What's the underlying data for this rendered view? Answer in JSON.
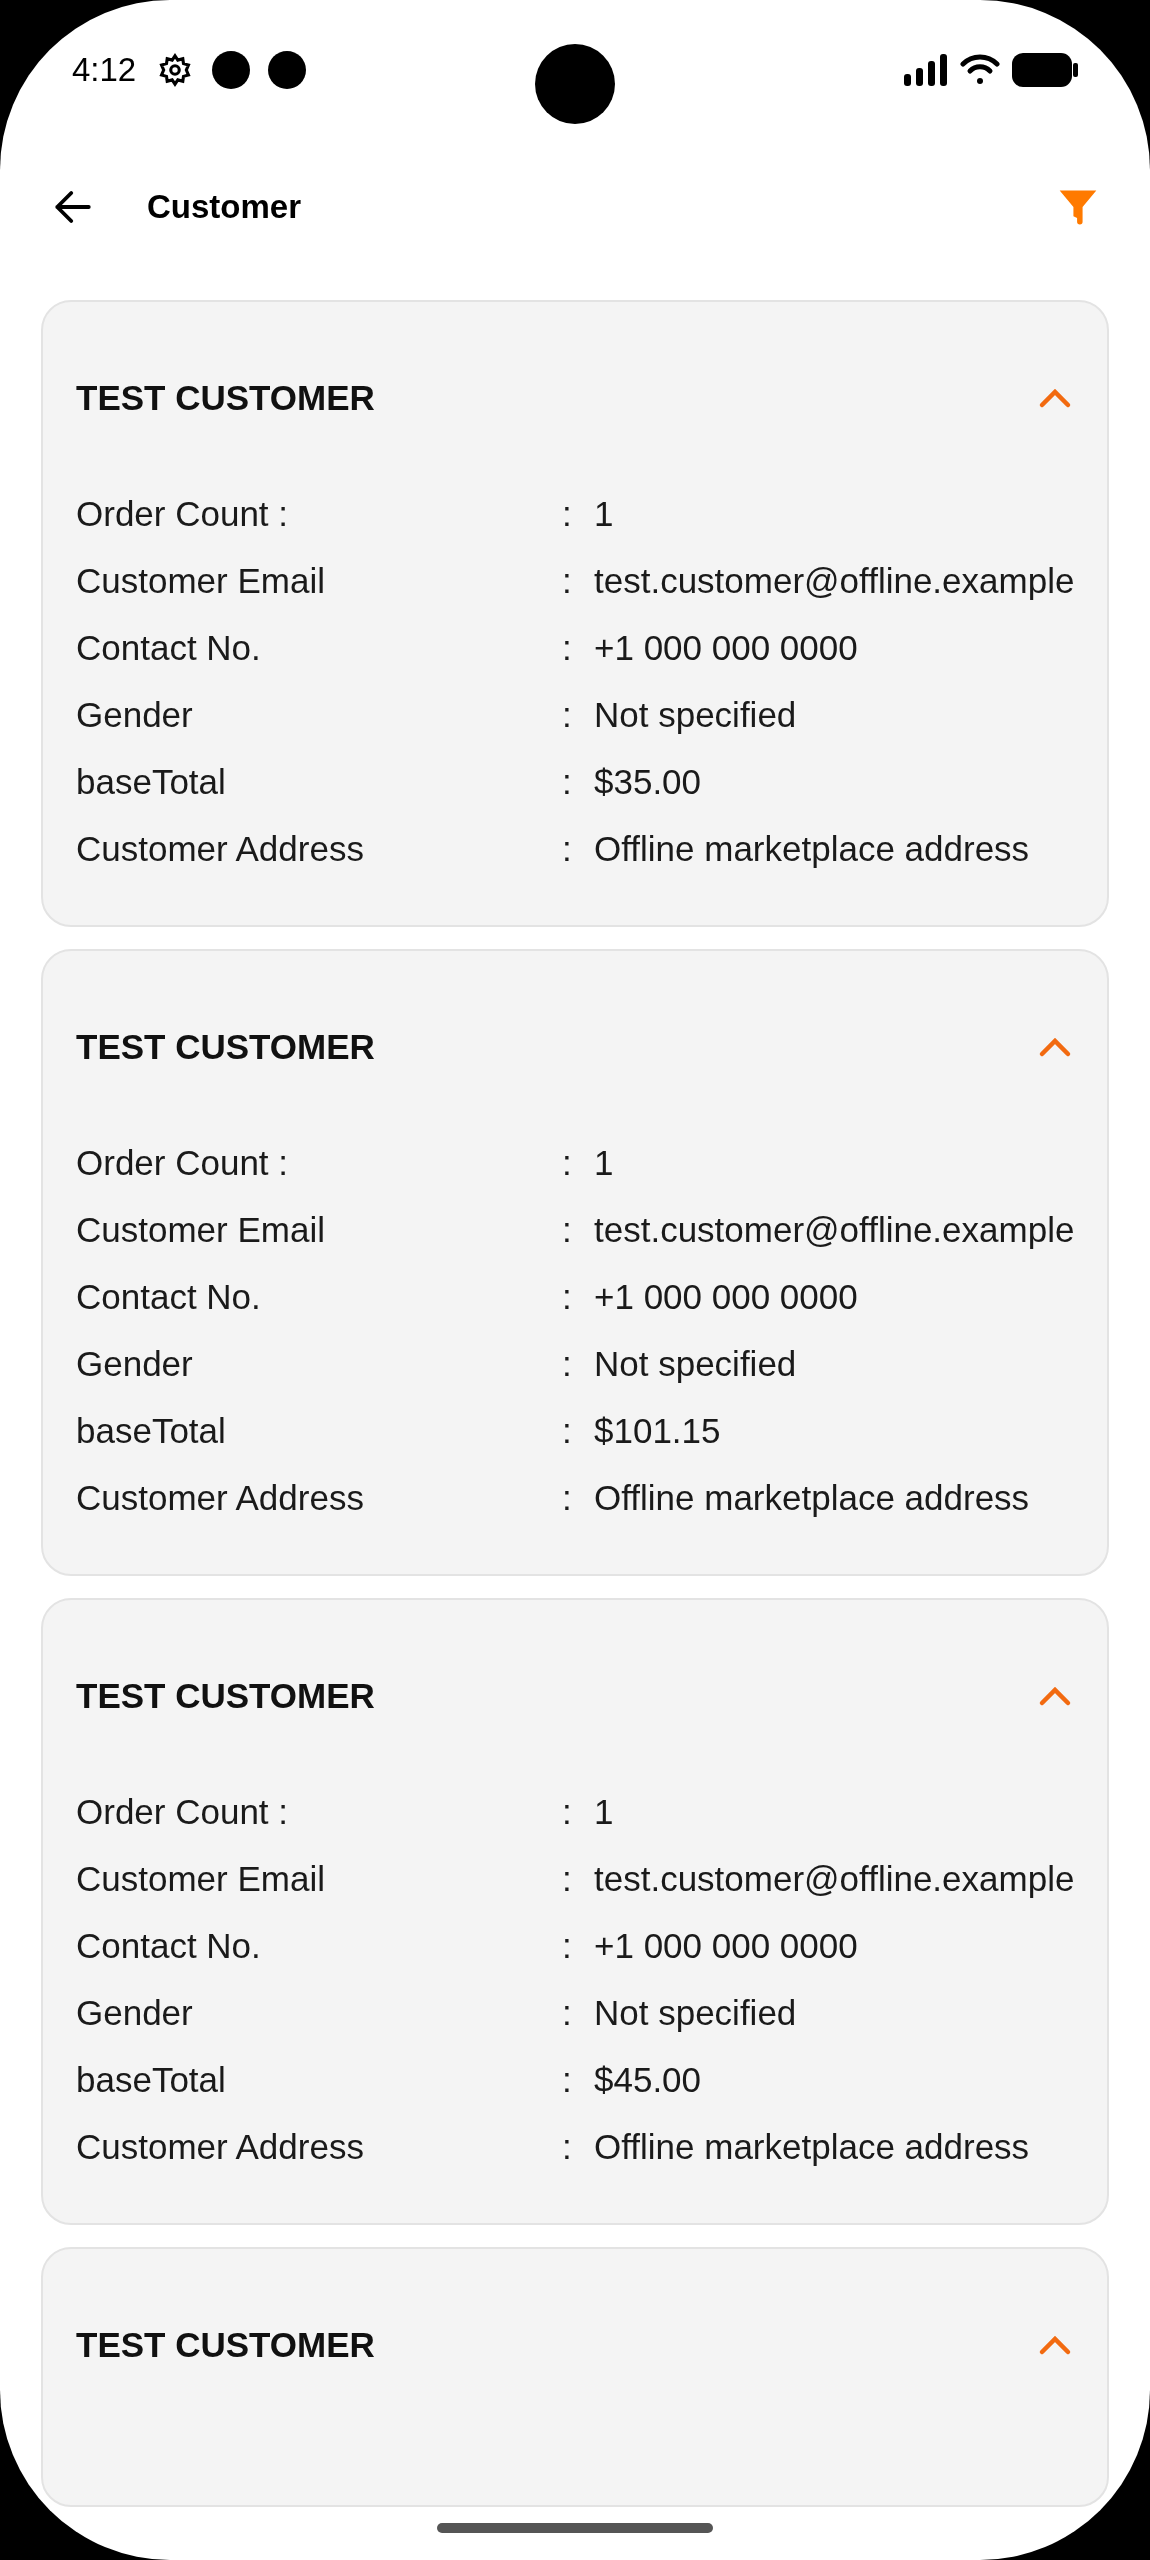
{
  "status_bar": {
    "time": "4:12"
  },
  "header": {
    "title": "Customer"
  },
  "cards": [
    {
      "name": "TEST CUSTOMER",
      "expanded": true,
      "fields": [
        {
          "label": "Order Count :",
          "separator": ":",
          "value": "1"
        },
        {
          "label": "Customer Email",
          "separator": ":",
          "value": "test.customer@offline.example"
        },
        {
          "label": "Contact No.",
          "separator": ":",
          "value": "+1 000 000 0000"
        },
        {
          "label": "Gender",
          "separator": ":",
          "value": "Not specified"
        },
        {
          "label": "baseTotal",
          "separator": ":",
          "value": "$35.00"
        },
        {
          "label": "Customer Address",
          "separator": ":",
          "value": "Offline marketplace address"
        }
      ]
    },
    {
      "name": "TEST CUSTOMER",
      "expanded": true,
      "fields": [
        {
          "label": "Order Count :",
          "separator": ":",
          "value": "1"
        },
        {
          "label": "Customer Email",
          "separator": ":",
          "value": "test.customer@offline.example"
        },
        {
          "label": "Contact No.",
          "separator": ":",
          "value": "+1 000 000 0000"
        },
        {
          "label": "Gender",
          "separator": ":",
          "value": "Not specified"
        },
        {
          "label": "baseTotal",
          "separator": ":",
          "value": "$101.15"
        },
        {
          "label": "Customer Address",
          "separator": ":",
          "value": "Offline marketplace address"
        }
      ]
    },
    {
      "name": "TEST CUSTOMER",
      "expanded": true,
      "fields": [
        {
          "label": "Order Count :",
          "separator": ":",
          "value": "1"
        },
        {
          "label": "Customer Email",
          "separator": ":",
          "value": "test.customer@offline.example"
        },
        {
          "label": "Contact No.",
          "separator": ":",
          "value": "+1 000 000 0000"
        },
        {
          "label": "Gender",
          "separator": ":",
          "value": "Not specified"
        },
        {
          "label": "baseTotal",
          "separator": ":",
          "value": "$45.00"
        },
        {
          "label": "Customer Address",
          "separator": ":",
          "value": "Offline marketplace address"
        }
      ]
    },
    {
      "name": "TEST CUSTOMER",
      "expanded": true
    }
  ]
}
